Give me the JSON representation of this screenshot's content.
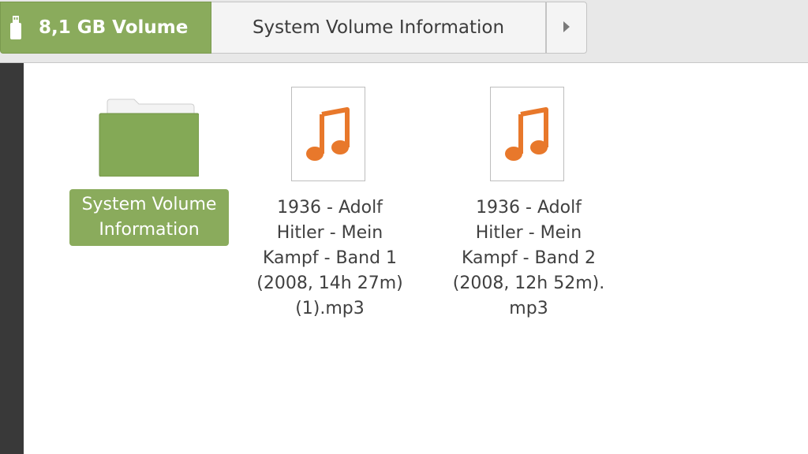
{
  "breadcrumb": {
    "volume_label": "8,1 GB Volume",
    "folder_label": "System Volume Information",
    "next_icon": "chevron-right-icon"
  },
  "colors": {
    "accent": "#8aab5c",
    "sidebar": "#393939",
    "music_icon": "#e8782b"
  },
  "items": [
    {
      "type": "folder",
      "icon": "folder-icon",
      "label_lines": [
        "System Volume",
        "Information"
      ],
      "selected": true
    },
    {
      "type": "audio",
      "icon": "audio-file-icon",
      "label_lines": [
        "1936 - Adolf",
        "Hitler - Mein",
        "Kampf - Band 1",
        "(2008, 14h 27m)",
        "(1).mp3"
      ],
      "selected": false
    },
    {
      "type": "audio",
      "icon": "audio-file-icon",
      "label_lines": [
        "1936 - Adolf",
        "Hitler - Mein",
        "Kampf - Band 2",
        "(2008, 12h 52m).",
        "mp3"
      ],
      "selected": false
    }
  ]
}
